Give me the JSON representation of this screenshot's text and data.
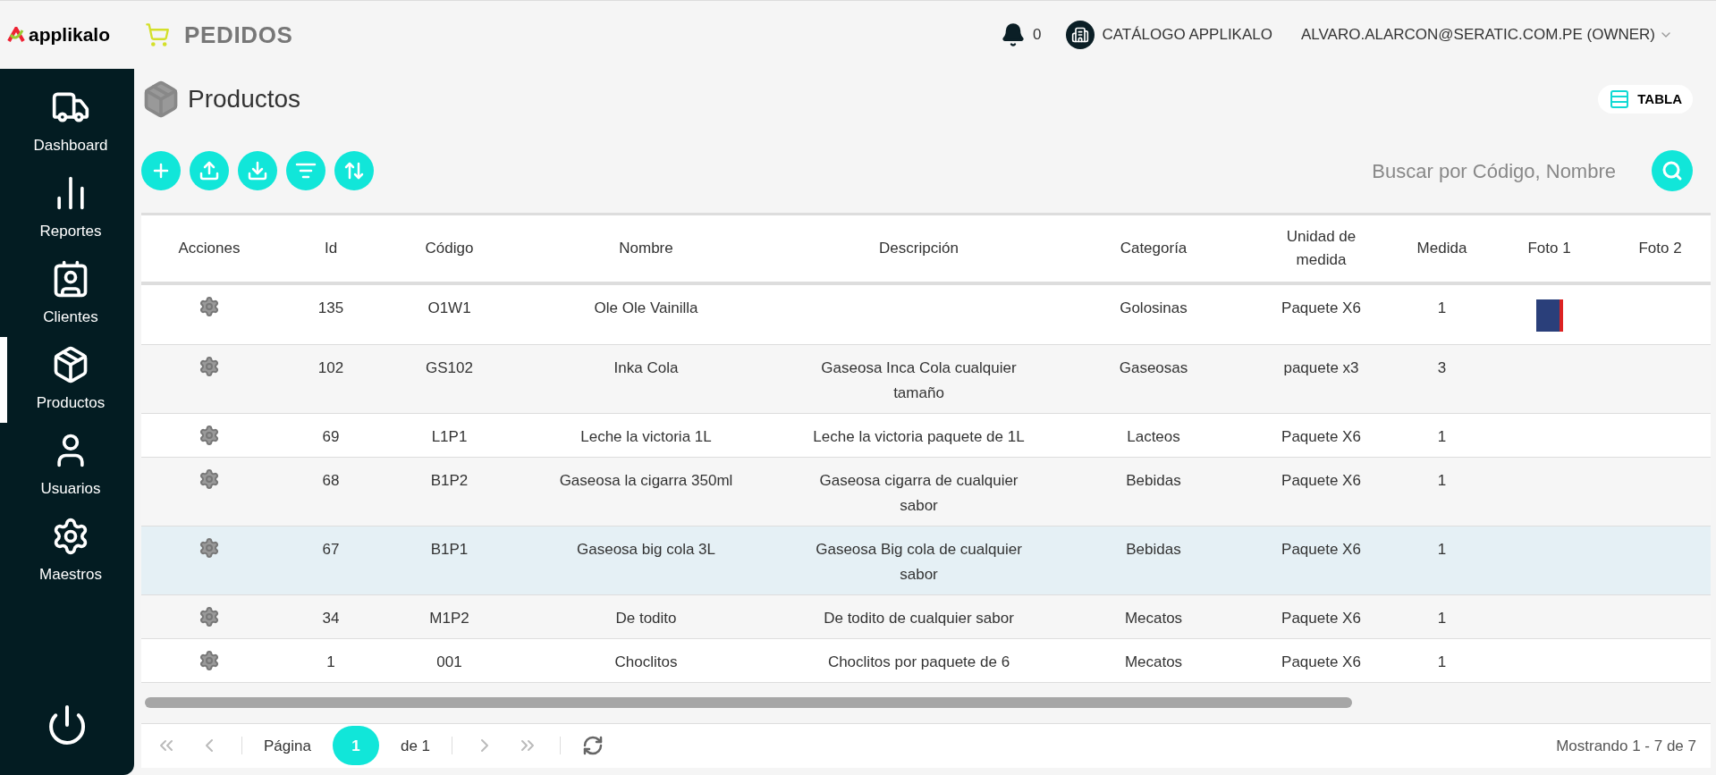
{
  "header": {
    "logo": "applikalo",
    "module": "PEDIDOS",
    "notifications": "0",
    "catalog": "CATÁLOGO APPLIKALO",
    "user": "ALVARO.ALARCON@SERATIC.COM.PE (OWNER)"
  },
  "sidebar": {
    "items": [
      {
        "label": "Dashboard",
        "selected": false
      },
      {
        "label": "Reportes",
        "selected": false
      },
      {
        "label": "Clientes",
        "selected": false
      },
      {
        "label": "Productos",
        "selected": true
      },
      {
        "label": "Usuarios",
        "selected": false
      },
      {
        "label": "Maestros",
        "selected": false
      }
    ]
  },
  "page": {
    "title": "Productos",
    "view_toggle": "TABLA"
  },
  "toolbar": {
    "search": {
      "placeholder": "Buscar por Código, Nombre"
    }
  },
  "table": {
    "columns": [
      "Acciones",
      "Id",
      "Código",
      "Nombre",
      "Descripción",
      "Categoría",
      "Unidad de medida",
      "Medida",
      "Foto 1",
      "Foto 2"
    ],
    "rows": [
      {
        "id": "135",
        "code": "O1W1",
        "name": "Ole Ole Vainilla",
        "description": "",
        "category": "Golosinas",
        "unit": "Paquete X6",
        "measure": "1",
        "photo_1": true,
        "selected": false
      },
      {
        "id": "102",
        "code": "GS102",
        "name": "Inka Cola",
        "description": "Gaseosa Inca Cola cualquier tamaño",
        "category": "Gaseosas",
        "unit": "paquete x3",
        "measure": "3",
        "photo_1": false,
        "selected": false
      },
      {
        "id": "69",
        "code": "L1P1",
        "name": "Leche la victoria 1L",
        "description": "Leche la victoria paquete de 1L",
        "category": "Lacteos",
        "unit": "Paquete X6",
        "measure": "1",
        "photo_1": false,
        "selected": false
      },
      {
        "id": "68",
        "code": "B1P2",
        "name": "Gaseosa la cigarra 350ml",
        "description": "Gaseosa cigarra de cualquier sabor",
        "category": "Bebidas",
        "unit": "Paquete X6",
        "measure": "1",
        "photo_1": false,
        "selected": false
      },
      {
        "id": "67",
        "code": "B1P1",
        "name": "Gaseosa big cola 3L",
        "description": "Gaseosa Big cola de cualquier sabor",
        "category": "Bebidas",
        "unit": "Paquete X6",
        "measure": "1",
        "photo_1": false,
        "selected": true
      },
      {
        "id": "34",
        "code": "M1P2",
        "name": "De todito",
        "description": "De todito de cualquier sabor",
        "category": "Mecatos",
        "unit": "Paquete X6",
        "measure": "1",
        "photo_1": false,
        "selected": false
      },
      {
        "id": "1",
        "code": "001",
        "name": "Choclitos",
        "description": "Choclitos por paquete de 6",
        "category": "Mecatos",
        "unit": "Paquete X6",
        "measure": "1",
        "photo_1": false,
        "selected": false
      }
    ]
  },
  "pager": {
    "page_label": "Página",
    "current_page": "1",
    "of_label": "de 1",
    "summary": "Mostrando 1 - 7 de 7"
  }
}
